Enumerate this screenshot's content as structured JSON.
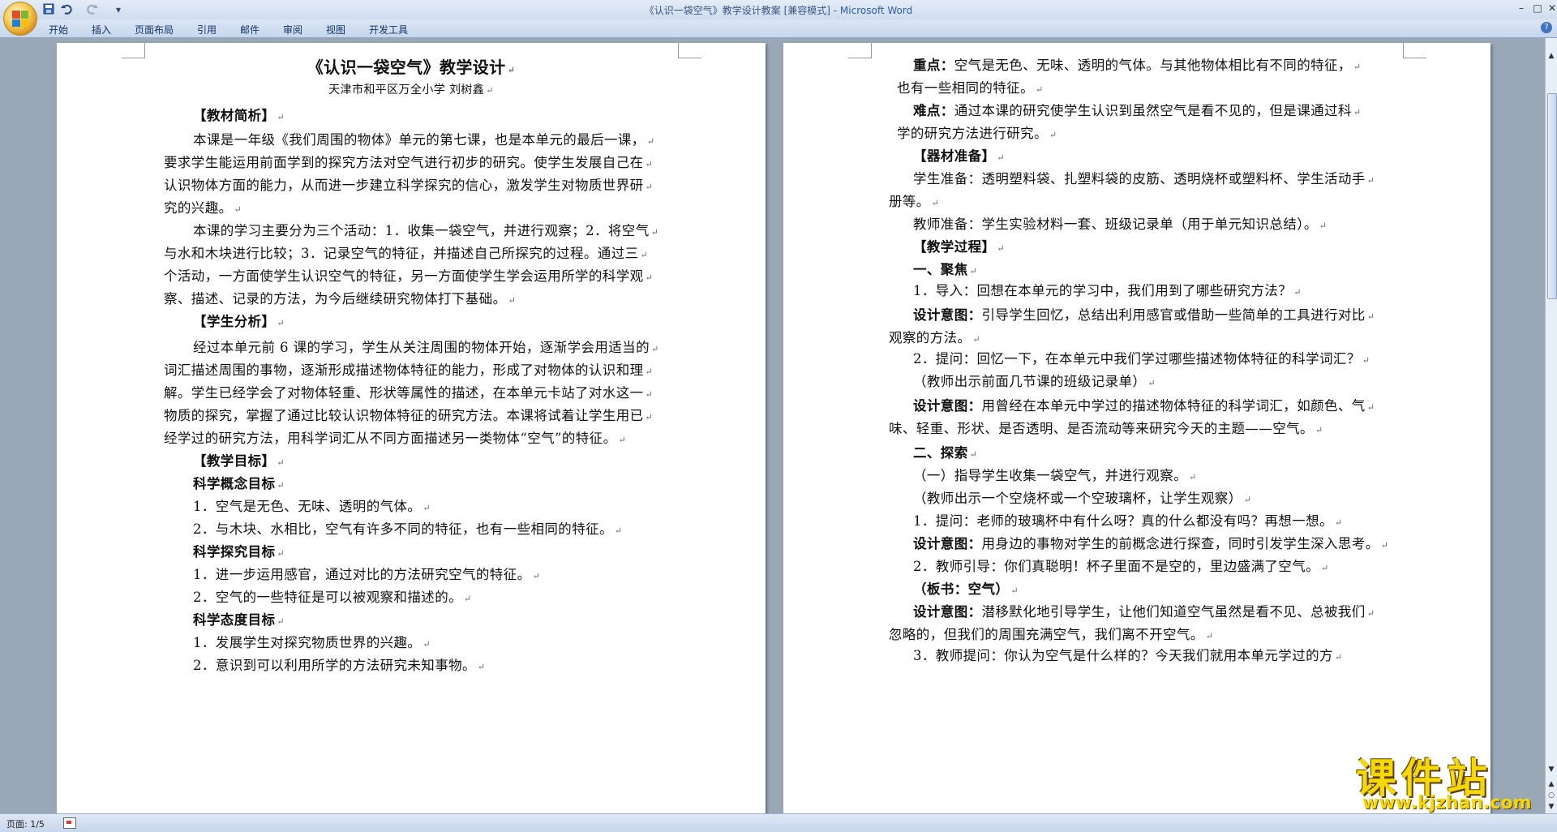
{
  "window": {
    "title_doc": "《认识一袋空气》教学设计教案 [兼容模式] - ",
    "title_app": "Microsoft Word",
    "controls": {
      "minimize": "–",
      "maximize": "□",
      "close": "✕"
    }
  },
  "quick_access": {
    "save": "save-icon",
    "undo": "undo-icon",
    "redo": "redo-icon",
    "more": "▾"
  },
  "ribbon": {
    "tabs": [
      "开始",
      "插入",
      "页面布局",
      "引用",
      "邮件",
      "审阅",
      "视图",
      "开发工具"
    ],
    "help": "?"
  },
  "page_left": {
    "title": "《认识一袋空气》教学设计",
    "subtitle": "天津市和平区万全小学    刘树鑫",
    "lines": [
      "【教材简析】",
      "本课是一年级《我们周围的物体》单元的第七课，也是本单元的最后一课，",
      "要求学生能运用前面学到的探究方法对空气进行初步的研究。使学生发展自己在",
      "认识物体方面的能力，从而进一步建立科学探究的信心，激发学生对物质世界研",
      "究的兴趣。",
      "本课的学习主要分为三个活动：1．收集一袋空气，并进行观察；2．将空气",
      "与水和木块进行比较；3．记录空气的特征，并描述自己所探究的过程。通过三",
      "个活动，一方面使学生认识空气的特征，另一方面使学生学会运用所学的科学观",
      "察、描述、记录的方法，为今后继续研究物体打下基础。",
      "【学生分析】",
      "经过本单元前 6 课的学习，学生从关注周围的物体开始，逐渐学会用适当的",
      "词汇描述周围的事物，逐渐形成描述物体特征的能力，形成了对物体的认识和理",
      "解。学生已经学会了对物体轻重、形状等属性的描述，在本单元卡站了对水这一",
      "物质的探究，掌握了通过比较认识物体特征的研究方法。本课将试着让学生用已",
      "经学过的研究方法，用科学词汇从不同方面描述另一类物体“空气”的特征。",
      "【教学目标】",
      "科学概念目标",
      "1．空气是无色、无味、透明的气体。",
      "2．与木块、水相比，空气有许多不同的特征，也有一些相同的特征。",
      "科学探究目标",
      "1．进一步运用感官，通过对比的方法研究空气的特征。",
      "2．空气的一些特征是可以被观察和描述的。",
      "科学态度目标",
      "1．发展学生对探究物质世界的兴趣。",
      "2．意识到可以利用所学的方法研究未知事物。"
    ]
  },
  "page_right": {
    "lines": [
      {
        "label": "重点：",
        "text": "空气是无色、无味、透明的气体。与其他物体相比有不同的特征，"
      },
      {
        "label": "",
        "text": "也有一些相同的特征。"
      },
      {
        "label": "难点：",
        "text": "通过本课的研究使学生认识到虽然空气是看不见的，但是课通过科"
      },
      {
        "label": "",
        "text": "学的研究方法进行研究。"
      },
      {
        "label": "【器材准备】",
        "text": ""
      },
      {
        "label": "",
        "text": "学生准备：透明塑料袋、扎塑料袋的皮筋、透明烧杯或塑料杯、学生活动手"
      },
      {
        "label": "",
        "text": "册等。"
      },
      {
        "label": "",
        "text": "教师准备：学生实验材料一套、班级记录单（用于单元知识总结）。"
      },
      {
        "label": "【教学过程】",
        "text": ""
      },
      {
        "label": "一、聚焦",
        "text": ""
      },
      {
        "label": "",
        "text": "1．导入：回想在本单元的学习中，我们用到了哪些研究方法？"
      },
      {
        "label": "设计意图：",
        "text": "引导学生回忆，总结出利用感官或借助一些简单的工具进行对比"
      },
      {
        "label": "",
        "text": "观察的方法。"
      },
      {
        "label": "",
        "text": "2．提问：回忆一下，在本单元中我们学过哪些描述物体特征的科学词汇？"
      },
      {
        "label": "",
        "text": "（教师出示前面几节课的班级记录单）"
      },
      {
        "label": "设计意图：",
        "text": "用曾经在本单元中学过的描述物体特征的科学词汇，如颜色、气"
      },
      {
        "label": "",
        "text": "味、轻重、形状、是否透明、是否流动等来研究今天的主题——空气。"
      },
      {
        "label": "二、探索",
        "text": ""
      },
      {
        "label": "",
        "text": "（一）指导学生收集一袋空气，并进行观察。"
      },
      {
        "label": "",
        "text": "（教师出示一个空烧杯或一个空玻璃杯，让学生观察）"
      },
      {
        "label": "",
        "text": "1．提问：老师的玻璃杯中有什么呀？真的什么都没有吗？再想一想。"
      },
      {
        "label": "设计意图：",
        "text": "用身边的事物对学生的前概念进行探查，同时引发学生深入思考。"
      },
      {
        "label": "",
        "text": "2．教师引导：你们真聪明！杯子里面不是空的，里边盛满了空气。"
      },
      {
        "label": "（板书：空气）",
        "text": ""
      },
      {
        "label": "设计意图：",
        "text": "潜移默化地引导学生，让他们知道空气虽然是看不见、总被我们"
      },
      {
        "label": "",
        "text": "忽略的，但我们的周围充满空气，我们离不开空气。"
      },
      {
        "label": "",
        "text": "3．教师提问：你认为空气是什么样的？今天我们就用本单元学过的方"
      }
    ]
  },
  "marks": {
    "para": "↵"
  },
  "status": {
    "page": "页面: 1/5"
  },
  "watermark": {
    "big": "课件站",
    "small": "www.kjzhan.com"
  },
  "colors": {
    "workspace": "#9aa7b7",
    "title_accent": "#2c5dac",
    "watermark": "#f5d800"
  }
}
